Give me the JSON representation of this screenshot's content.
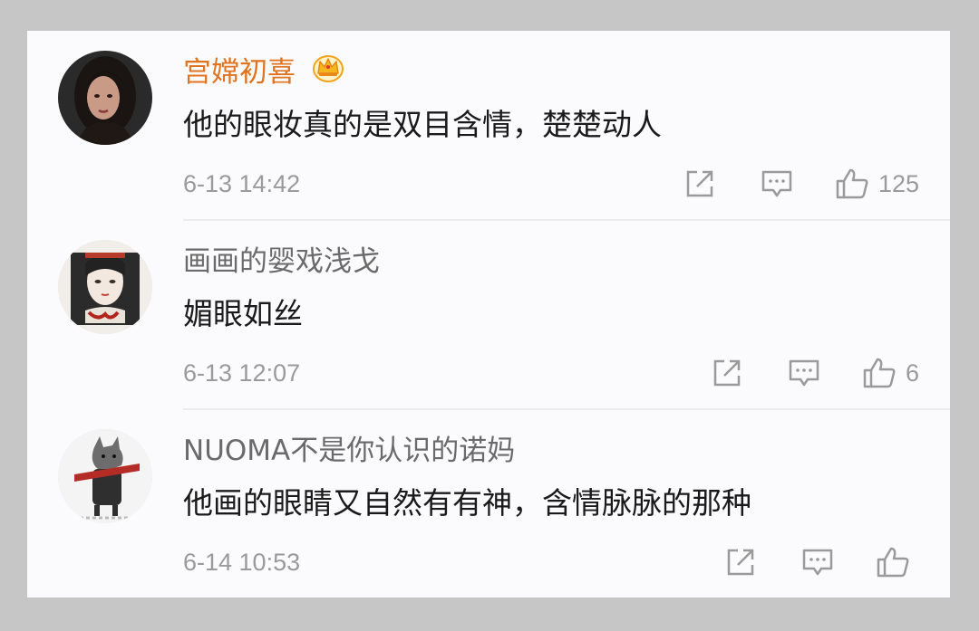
{
  "comments": [
    {
      "username": "宫嫦初喜",
      "text": "他的眼妆真的是双目含情，楚楚动人",
      "time": "6-13 14:42",
      "likes": "125",
      "vip": true
    },
    {
      "username": "画画的婴戏浅戈",
      "text": "媚眼如丝",
      "time": "6-13 12:07",
      "likes": "6",
      "vip": false
    },
    {
      "username": "NUOMA不是你认识的诺妈",
      "text": "他画的眼睛又自然有有神，含情脉脉的那种",
      "time": "6-14 10:53",
      "likes": "",
      "vip": false
    }
  ],
  "icons": {
    "share": "share-icon",
    "reply": "comment-icon",
    "like": "thumbs-up-icon",
    "vip": "crown-icon"
  },
  "colors": {
    "vip_name": "#e0731f",
    "name": "#6a6a6a",
    "text": "#1a1a1a",
    "meta": "#9a9a9a",
    "background": "#c6c6c6",
    "card": "#fbfbfd"
  }
}
